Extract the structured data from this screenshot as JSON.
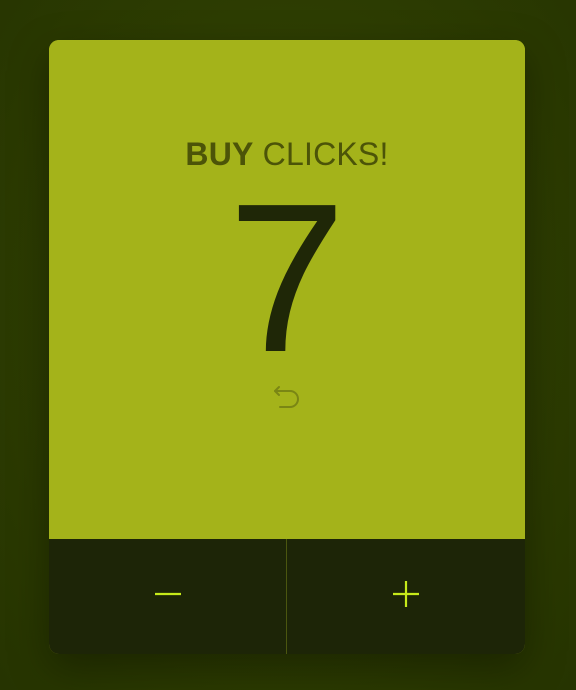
{
  "card": {
    "title_bold": "BUY",
    "title_light": " CLICKS!",
    "count": "7"
  },
  "controls": {
    "decrement_icon": "minus-icon",
    "increment_icon": "plus-icon",
    "reset_icon": "undo-arrow-icon"
  },
  "colors": {
    "background": "#2f3f02",
    "card": "#a4b31a",
    "controls_bar": "#1d2507",
    "accent": "#c6ea1a",
    "count_text": "#1f2707",
    "title_text": "#4c5408"
  }
}
